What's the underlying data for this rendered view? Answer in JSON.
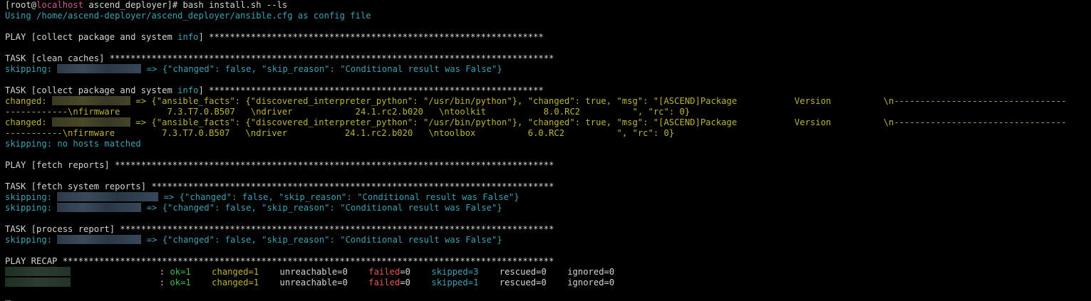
{
  "prompt": {
    "open": "[root@",
    "host": "localhost",
    "path": " ascend_deployer]# ",
    "command": "bash install.sh --ls"
  },
  "config_line": "Using /home/ascend-deployer/ascend_deployer/ansible.cfg as config file",
  "play1": {
    "prefix": "PLAY [collect package and system ",
    "keyword": "info",
    "suffix": "] ****************************************************************"
  },
  "task1": {
    "text": "TASK [clean caches] *************************************************************************************"
  },
  "task1_skip": {
    "label": "skipping: ",
    "rest": " => {\"changed\": false, \"skip_reason\": \"Conditional result was False\"}"
  },
  "task2": {
    "prefix": "TASK [collect package and system ",
    "keyword": "info",
    "suffix": "] ****************************************************************"
  },
  "changed1": {
    "label": "changed: ",
    "rest": " => {\"ansible_facts\": {\"discovered_interpreter_python\": \"/usr/bin/python\"}, \"changed\": true, \"msg\": \"[ASCEND]Package           Version          \\n---------------------------------",
    "cont": "------------\\nfirmware         7.3.T7.0.B507   \\ndriver            24.1.rc2.b020   \\ntoolkit           8.0.RC2          \", \"rc\": 0}"
  },
  "changed2": {
    "label": "changed: ",
    "rest": " => {\"ansible_facts\": {\"discovered_interpreter_python\": \"/usr/bin/python\"}, \"changed\": true, \"msg\": \"[ASCEND]Package           Version          \\n---------------------------------",
    "cont": "-----------\\nfirmware         7.3.T7.0.B507   \\ndriver           24.1.rc2.b020   \\ntoolbox          6.0.RC2          \", \"rc\": 0}"
  },
  "no_hosts": "skipping: no hosts matched",
  "play2": {
    "text": "PLAY [fetch reports] ************************************************************************************"
  },
  "task3": {
    "text": "TASK [fetch system reports] *****************************************************************************"
  },
  "task3_skip1": {
    "label": "skipping: ",
    "rest": " => {\"changed\": false, \"skip_reason\": \"Conditional result was False\"}"
  },
  "task3_skip2": {
    "label": "skipping: ",
    "rest": " => {\"changed\": false, \"skip_reason\": \"Conditional result was False\"}"
  },
  "task4": {
    "text": "TASK [process report] ***********************************************************************************"
  },
  "task4_skip": {
    "label": "skipping: ",
    "rest": " => {\"changed\": false, \"skip_reason\": \"Conditional result was False\"}"
  },
  "recap": {
    "text": "PLAY RECAP **********************************************************************************************"
  },
  "recap_rows": [
    {
      "ok": "ok=1",
      "changed": "changed=1",
      "unreachable": "unreachable=0",
      "failed_label": "failed",
      "failed_val": "=0",
      "skipped": "skipped=3",
      "rescued": "rescued=0",
      "ignored": "ignored=0"
    },
    {
      "ok": "ok=1",
      "changed": "changed=1",
      "unreachable": "unreachable=0",
      "failed_label": "failed",
      "failed_val": "=0",
      "skipped": "skipped=1",
      "rescued": "rescued=0",
      "ignored": "ignored=0"
    }
  ],
  "colors": {
    "background": "#000000",
    "text": "#d4d4d4",
    "skipping": "#3aa0b4",
    "changed": "#bcb32e",
    "ok": "#3ebd4e",
    "failed": "#e05757",
    "hostname": "#d25592"
  }
}
